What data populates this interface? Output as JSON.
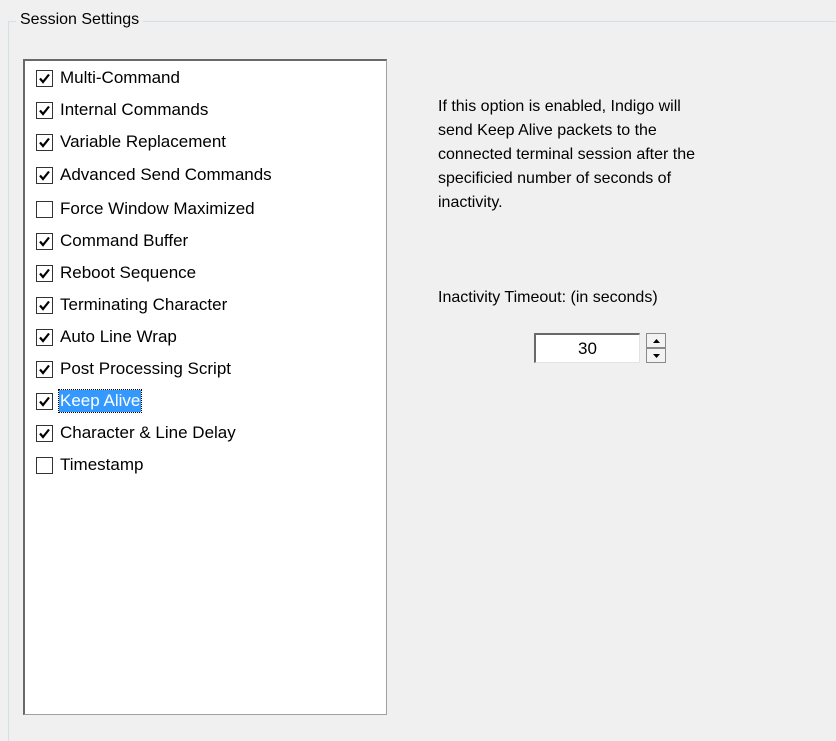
{
  "groupbox": {
    "title": "Session Settings"
  },
  "options": [
    {
      "label": "Multi-Command",
      "checked": true
    },
    {
      "label": "Internal Commands",
      "checked": true
    },
    {
      "label": "Variable Replacement",
      "checked": true
    },
    {
      "label": "Advanced Send Commands",
      "checked": true
    },
    {
      "label": "Force Window Maximized",
      "checked": false
    },
    {
      "label": "Command Buffer",
      "checked": true
    },
    {
      "label": "Reboot Sequence",
      "checked": true
    },
    {
      "label": "Terminating Character",
      "checked": true
    },
    {
      "label": "Auto Line Wrap",
      "checked": true
    },
    {
      "label": "Post Processing Script",
      "checked": true
    },
    {
      "label": "Keep Alive",
      "checked": true,
      "selected": true
    },
    {
      "label": "Character & Line Delay",
      "checked": true
    },
    {
      "label": "Timestamp",
      "checked": false
    }
  ],
  "description": "If this option is enabled, Indigo will\nsend Keep Alive packets to the\nconnected terminal session after the\nspecificied number of seconds of\ninactivity.",
  "timeout": {
    "label": "Inactivity Timeout: (in seconds)",
    "value": "30"
  },
  "colors": {
    "selection": "#3399ff",
    "background": "#f0f0f0"
  }
}
